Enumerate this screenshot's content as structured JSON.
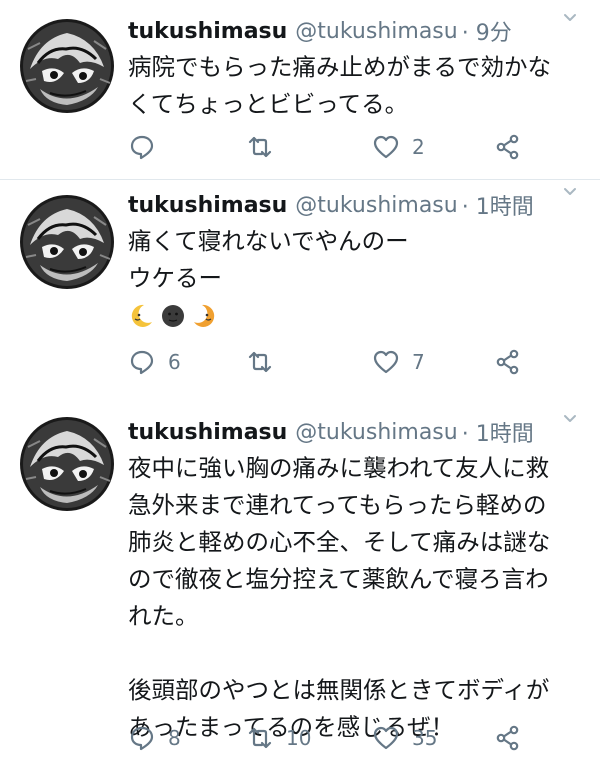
{
  "tweets": [
    {
      "name": "tukushimasu",
      "handle": "@tukushimasu",
      "time": "· 9分",
      "text": "病院でもらった痛み止めがまるで効かな\nくてちょっとビビってる。",
      "reply_count": "",
      "retweet_count": "",
      "like_count": "2"
    },
    {
      "name": "tukushimasu",
      "handle": "@tukushimasu",
      "time": "· 1時間",
      "text": "痛くて寝れないでやんのー\nウケるー",
      "emojis": [
        "crescent-moon-face-icon",
        "new-moon-face-icon",
        "crescent-moon-face-icon"
      ],
      "reply_count": "6",
      "retweet_count": "",
      "like_count": "7"
    },
    {
      "name": "tukushimasu",
      "handle": "@tukushimasu",
      "time": "· 1時間",
      "text": "夜中に強い胸の痛みに襲われて友人に救\n急外来まで連れてってもらったら軽めの\n肺炎と軽めの心不全、そして痛みは謎な\nので徹夜と塩分控えて薬飲んで寝ろ言わ\nれた。\n\n後頭部のやつとは無関係ときてボディが\nあったまってるのを感じるぜ！",
      "reply_count": "8",
      "retweet_count": "10",
      "like_count": "35"
    }
  ],
  "colors": {
    "text": "#14171a",
    "secondary": "#657786",
    "separator": "#e1e8ed"
  }
}
